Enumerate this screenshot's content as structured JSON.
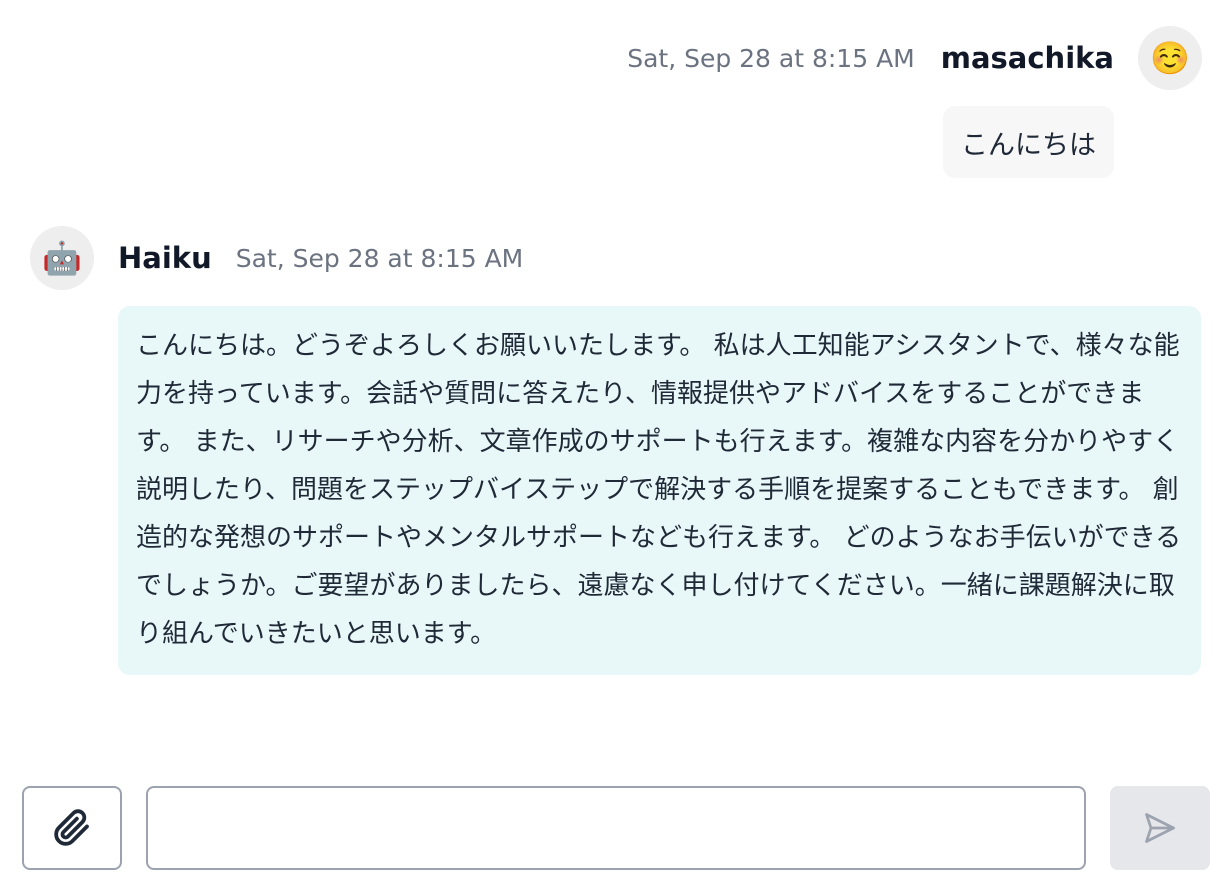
{
  "user_message": {
    "timestamp": "Sat, Sep 28 at 8:15 AM",
    "sender": "masachika",
    "avatar_emoji": "☺️",
    "text": "こんにちは"
  },
  "assistant_message": {
    "sender": "Haiku",
    "timestamp": "Sat, Sep 28 at 8:15 AM",
    "avatar_emoji": "🤖",
    "text": "こんにちは。どうぞよろしくお願いいたします。 私は人工知能アシスタントで、様々な能力を持っています。会話や質問に答えたり、情報提供やアドバイスをすることができます。 また、リサーチや分析、文章作成のサポートも行えます。複雑な内容を分かりやすく説明したり、問題をステップバイステップで解決する手順を提案することもできます。 創造的な発想のサポートやメンタルサポートなども行えます。 どのようなお手伝いができるでしょうか。ご要望がありましたら、遠慮なく申し付けてください。一緒に課題解決に取り組んでいきたいと思います。"
  },
  "composer": {
    "input_value": "",
    "attach_icon": "paperclip-icon",
    "send_icon": "send-icon"
  },
  "colors": {
    "user_bubble": "#f7f7f7",
    "assistant_bubble": "#e8f7f7",
    "avatar_bg": "#eeeeee",
    "border": "#9ca3af",
    "send_button_bg": "#e5e7eb",
    "timestamp": "#6b7280"
  }
}
